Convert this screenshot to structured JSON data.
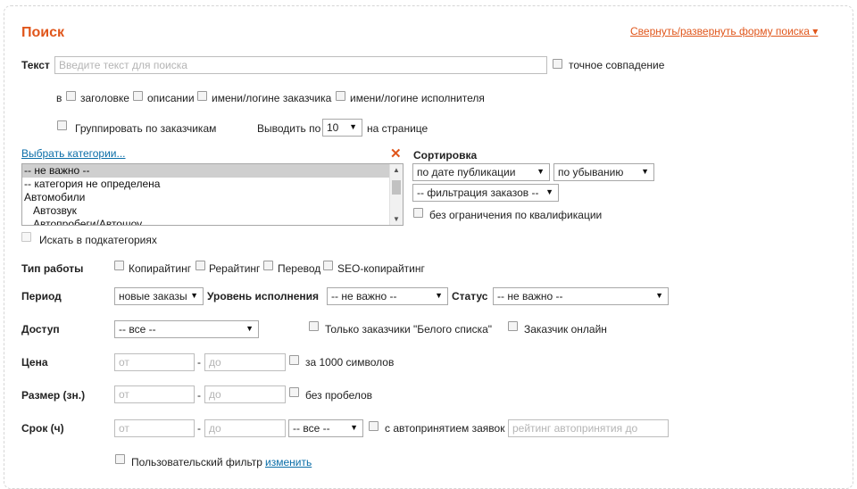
{
  "header": {
    "title": "Поиск",
    "toggle_label": "Свернуть/развернуть форму поиска ▾"
  },
  "text_search": {
    "label": "Текст",
    "placeholder": "Введите текст для поиска",
    "exact_match_label": "точное совпадение"
  },
  "search_in": {
    "prefix": "в",
    "options": [
      "заголовке",
      "описании",
      "имени/логине заказчика",
      "имени/логине исполнителя"
    ]
  },
  "group_by_customer_label": "Группировать по заказчикам",
  "per_page": {
    "label_before": "Выводить по",
    "value": "10",
    "label_after": "на странице"
  },
  "categories": {
    "link_label": "Выбрать категории...",
    "clear_icon": "close-icon",
    "items": [
      "-- не важно --",
      "-- категория не определена",
      "Автомобили",
      "Автозвук",
      "Автопробеги/Автошоу"
    ],
    "selected_index": 0,
    "subcategories_label": "Искать в подкатегориях"
  },
  "sorting": {
    "label": "Сортировка",
    "sort_by": "по дате публикации",
    "order": "по убыванию",
    "filter": "-- фильтрация заказов --",
    "no_qualification_label": "без ограничения по квалификации"
  },
  "work_type": {
    "label": "Тип работы",
    "options": [
      "Копирайтинг",
      "Рерайтинг",
      "Перевод",
      "SEO-копирайтинг"
    ]
  },
  "period": {
    "label": "Период",
    "value": "новые заказы",
    "level_label": "Уровень исполнения",
    "level_value": "-- не важно --",
    "status_label": "Статус",
    "status_value": "-- не важно --"
  },
  "access": {
    "label": "Доступ",
    "value": "-- все --",
    "whitelist_label": "Только заказчики \"Белого списка\"",
    "online_label": "Заказчик онлайн"
  },
  "price": {
    "label": "Цена",
    "from_placeholder": "от",
    "to_placeholder": "до",
    "dash": "-",
    "per_label": "за 1000 символов"
  },
  "size": {
    "label": "Размер (зн.)",
    "from_placeholder": "от",
    "to_placeholder": "до",
    "dash": "-",
    "no_spaces_label": "без пробелов"
  },
  "deadline": {
    "label": "Срок (ч)",
    "from_placeholder": "от",
    "to_placeholder": "до",
    "dash": "-",
    "select_value": "-- все --",
    "auto_accept_label": "с автопринятием заявок",
    "rating_placeholder": "рейтинг автопринятия до"
  },
  "custom_filter": {
    "label": "Пользовательский фильтр",
    "link": "изменить"
  },
  "colors": {
    "accent": "#e0561b",
    "link": "#0b6ea8"
  }
}
